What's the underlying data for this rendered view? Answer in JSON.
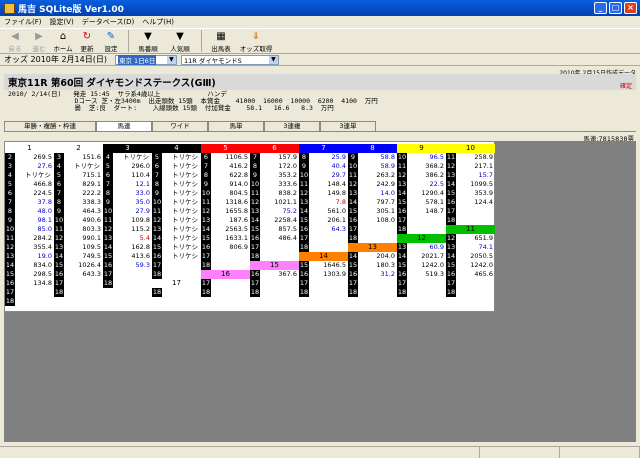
{
  "window": {
    "title": "馬吉 SQLite版  Ver1.00"
  },
  "menu": [
    "ファイル(F)",
    "設定(V)",
    "データベース(D)",
    "ヘルプ(H)"
  ],
  "toolbar": [
    {
      "label": "戻る",
      "icon": "back-arrow-icon",
      "disabled": true
    },
    {
      "label": "進む",
      "icon": "forward-arrow-icon",
      "disabled": true
    },
    {
      "label": "ホーム",
      "icon": "home-icon",
      "disabled": false
    },
    {
      "label": "更新",
      "icon": "refresh-icon",
      "disabled": false
    },
    {
      "label": "設定",
      "icon": "settings-icon",
      "disabled": false
    },
    {
      "label": "馬番順",
      "icon": "sort-down-icon",
      "disabled": false
    },
    {
      "label": "人気順",
      "icon": "sort-down-icon",
      "disabled": false
    },
    {
      "label": "出馬表",
      "icon": "table-icon",
      "disabled": false
    },
    {
      "label": "オッズ取得",
      "icon": "download-icon",
      "disabled": false
    }
  ],
  "nav": {
    "label": "オッズ 2010年 2月14日(日)",
    "venue": "東京 1日6日",
    "race": "11R ダイヤモンドS"
  },
  "date_note": "2010年 2月15日作成データ",
  "race": {
    "title": "東京11R 第60回 ダイヤモンドステークス(GⅢ)",
    "status": "確定",
    "info": [
      "2010/ 2/14(日)   発走 15:45  サラ系4歳以上            ハンデ",
      "                 Dコース 芝・左3400m  出走頭数 15頭  本賞金    41000  16000  10000  6200  4100  万円",
      "                 曇  芝:良  ダート:    入線頭数 15頭  付加賞金    58.1   16.6   8.3  万円"
    ]
  },
  "tabs": [
    "単勝・複勝・枠連",
    "馬連",
    "ワイド",
    "馬単",
    "3連複",
    "3連単"
  ],
  "active_tab": 1,
  "votes": "馬連:7815838票",
  "grid": {
    "headers": [
      {
        "label": "1",
        "bg": "#ffffff",
        "fg": "#000000"
      },
      {
        "label": "2",
        "bg": "#ffffff",
        "fg": "#000000"
      },
      {
        "label": "3",
        "bg": "#000000",
        "fg": "#ffffff"
      },
      {
        "label": "4",
        "bg": "#000000",
        "fg": "#ffffff"
      },
      {
        "label": "5",
        "bg": "#ff0000",
        "fg": "#ffffff"
      },
      {
        "label": "6",
        "bg": "#ff0000",
        "fg": "#ffffff"
      },
      {
        "label": "7",
        "bg": "#0000ff",
        "fg": "#ffffff"
      },
      {
        "label": "8",
        "bg": "#0000ff",
        "fg": "#ffffff"
      },
      {
        "label": "9",
        "bg": "#ffff00",
        "fg": "#000000"
      },
      {
        "label": "10",
        "bg": "#ffff00",
        "fg": "#000000"
      }
    ],
    "columns": [
      [
        [
          "2",
          "269.5",
          ""
        ],
        [
          "3",
          "27.6",
          "blue"
        ],
        [
          "4",
          "トリケシ",
          ""
        ],
        [
          "5",
          "466.8",
          ""
        ],
        [
          "6",
          "224.5",
          ""
        ],
        [
          "7",
          "37.8",
          "blue"
        ],
        [
          "8",
          "48.0",
          "blue"
        ],
        [
          "9",
          "98.1",
          "blue"
        ],
        [
          "10",
          "85.0",
          "blue"
        ],
        [
          "11",
          "284.2",
          ""
        ],
        [
          "12",
          "355.4",
          ""
        ],
        [
          "13",
          "19.0",
          "blue"
        ],
        [
          "14",
          "834.0",
          ""
        ],
        [
          "15",
          "298.5",
          ""
        ],
        [
          "16",
          "134.8",
          ""
        ],
        [
          "17",
          "",
          ""
        ],
        [
          "18",
          "",
          ""
        ]
      ],
      [
        [
          "3",
          "151.6",
          ""
        ],
        [
          "4",
          "トリケシ",
          ""
        ],
        [
          "5",
          "715.1",
          ""
        ],
        [
          "6",
          "829.1",
          ""
        ],
        [
          "7",
          "222.2",
          ""
        ],
        [
          "8",
          "338.3",
          ""
        ],
        [
          "9",
          "464.3",
          ""
        ],
        [
          "10",
          "490.6",
          ""
        ],
        [
          "11",
          "803.3",
          ""
        ],
        [
          "12",
          "990.1",
          ""
        ],
        [
          "13",
          "109.5",
          ""
        ],
        [
          "14",
          "749.5",
          ""
        ],
        [
          "15",
          "1026.4",
          ""
        ],
        [
          "16",
          "643.3",
          ""
        ],
        [
          "17",
          "",
          ""
        ],
        [
          "18",
          "",
          ""
        ]
      ],
      [
        [
          "4",
          "トリケシ",
          ""
        ],
        [
          "5",
          "296.0",
          ""
        ],
        [
          "6",
          "110.4",
          ""
        ],
        [
          "7",
          "12.1",
          "blue"
        ],
        [
          "8",
          "33.0",
          "blue"
        ],
        [
          "9",
          "35.0",
          "blue"
        ],
        [
          "10",
          "27.9",
          "blue"
        ],
        [
          "11",
          "109.8",
          ""
        ],
        [
          "12",
          "115.2",
          ""
        ],
        [
          "13",
          "5.4",
          "red"
        ],
        [
          "14",
          "162.8",
          ""
        ],
        [
          "15",
          "413.6",
          ""
        ],
        [
          "16",
          "59.3",
          "blue"
        ],
        [
          "17",
          "",
          ""
        ],
        [
          "18",
          "",
          ""
        ]
      ],
      [
        [
          "5",
          "トリケシ",
          ""
        ],
        [
          "6",
          "トリケシ",
          ""
        ],
        [
          "7",
          "トリケシ",
          ""
        ],
        [
          "8",
          "トリケシ",
          ""
        ],
        [
          "9",
          "トリケシ",
          ""
        ],
        [
          "10",
          "トリケシ",
          ""
        ],
        [
          "11",
          "トリケシ",
          ""
        ],
        [
          "12",
          "トリケシ",
          ""
        ],
        [
          "13",
          "トリケシ",
          ""
        ],
        [
          "14",
          "トリケシ",
          ""
        ],
        [
          "15",
          "トリケシ",
          ""
        ],
        [
          "16",
          "トリケシ",
          ""
        ],
        [
          "17",
          "",
          ""
        ],
        [
          "18",
          "",
          ""
        ]
      ],
      [
        [
          "6",
          "1106.5",
          ""
        ],
        [
          "7",
          "416.2",
          ""
        ],
        [
          "8",
          "622.8",
          ""
        ],
        [
          "9",
          "914.0",
          ""
        ],
        [
          "10",
          "804.5",
          ""
        ],
        [
          "11",
          "1318.6",
          ""
        ],
        [
          "12",
          "1655.8",
          ""
        ],
        [
          "13",
          "187.6",
          ""
        ],
        [
          "14",
          "2563.5",
          ""
        ],
        [
          "15",
          "1633.1",
          ""
        ],
        [
          "16",
          "806.9",
          ""
        ],
        [
          "17",
          "",
          ""
        ],
        [
          "18",
          "",
          ""
        ]
      ],
      [
        [
          "7",
          "157.9",
          ""
        ],
        [
          "8",
          "172.0",
          ""
        ],
        [
          "9",
          "353.2",
          ""
        ],
        [
          "10",
          "333.6",
          ""
        ],
        [
          "11",
          "838.2",
          ""
        ],
        [
          "12",
          "1021.1",
          ""
        ],
        [
          "13",
          "75.2",
          "blue"
        ],
        [
          "14",
          "2258.4",
          ""
        ],
        [
          "15",
          "857.5",
          ""
        ],
        [
          "16",
          "486.4",
          ""
        ],
        [
          "17",
          "",
          ""
        ],
        [
          "18",
          "",
          ""
        ]
      ],
      [
        [
          "8",
          "25.9",
          "blue"
        ],
        [
          "9",
          "40.4",
          "blue"
        ],
        [
          "10",
          "29.7",
          "blue"
        ],
        [
          "11",
          "148.4",
          ""
        ],
        [
          "12",
          "149.8",
          ""
        ],
        [
          "13",
          "7.8",
          "red"
        ],
        [
          "14",
          "561.0",
          ""
        ],
        [
          "15",
          "206.1",
          ""
        ],
        [
          "16",
          "64.3",
          "blue"
        ],
        [
          "17",
          "",
          ""
        ],
        [
          "18",
          "",
          ""
        ]
      ],
      [
        [
          "9",
          "58.8",
          "blue"
        ],
        [
          "10",
          "58.9",
          "blue"
        ],
        [
          "11",
          "263.2",
          ""
        ],
        [
          "12",
          "242.9",
          ""
        ],
        [
          "13",
          "14.0",
          "blue"
        ],
        [
          "14",
          "797.7",
          ""
        ],
        [
          "15",
          "305.1",
          ""
        ],
        [
          "16",
          "108.0",
          ""
        ],
        [
          "17",
          "",
          ""
        ],
        [
          "18",
          "",
          ""
        ]
      ],
      [
        [
          "10",
          "96.5",
          "blue"
        ],
        [
          "11",
          "368.2",
          ""
        ],
        [
          "12",
          "386.2",
          ""
        ],
        [
          "13",
          "22.5",
          "blue"
        ],
        [
          "14",
          "1290.4",
          ""
        ],
        [
          "15",
          "578.1",
          ""
        ],
        [
          "16",
          "148.7",
          ""
        ],
        [
          "17",
          "",
          ""
        ],
        [
          "18",
          "",
          ""
        ]
      ],
      [
        [
          "11",
          "258.9",
          ""
        ],
        [
          "12",
          "217.1",
          ""
        ],
        [
          "13",
          "15.7",
          "blue"
        ],
        [
          "14",
          "1099.5",
          ""
        ],
        [
          "15",
          "353.9",
          ""
        ],
        [
          "16",
          "124.4",
          ""
        ],
        [
          "17",
          "",
          ""
        ],
        [
          "18",
          "",
          ""
        ]
      ]
    ],
    "lower": [
      {
        "col": 9,
        "header": {
          "label": "11",
          "bg": "#00c000",
          "fg": "#000000"
        },
        "rows": [
          [
            "12",
            "651.9",
            ""
          ],
          [
            "13",
            "74.1",
            "blue"
          ],
          [
            "14",
            "2050.5",
            ""
          ],
          [
            "15",
            "1242.0",
            ""
          ],
          [
            "16",
            "465.6",
            ""
          ],
          [
            "17",
            "",
            ""
          ],
          [
            "18",
            "",
            ""
          ]
        ]
      },
      {
        "col": 8,
        "header": {
          "label": "12",
          "bg": "#00c000",
          "fg": "#000000"
        },
        "rows": [
          [
            "13",
            "60.9",
            "blue"
          ],
          [
            "14",
            "2021.7",
            ""
          ],
          [
            "15",
            "1242.0",
            ""
          ],
          [
            "16",
            "519.3",
            ""
          ],
          [
            "17",
            "",
            ""
          ],
          [
            "18",
            "",
            ""
          ]
        ]
      },
      {
        "col": 7,
        "header": {
          "label": "13",
          "bg": "#ff8000",
          "fg": "#000000"
        },
        "rows": [
          [
            "14",
            "",
            ""
          ],
          [
            "15",
            "",
            ""
          ],
          [
            "16",
            "",
            ""
          ],
          [
            "17",
            "",
            ""
          ],
          [
            "18",
            "",
            ""
          ]
        ]
      },
      {
        "col": 6,
        "header": {
          "label": "14",
          "bg": "#ff8000",
          "fg": "#000000"
        },
        "rows": [
          [
            "15",
            "1646.5",
            ""
          ],
          [
            "16",
            "1303.9",
            ""
          ],
          [
            "17",
            "",
            ""
          ],
          [
            "18",
            "",
            ""
          ]
        ]
      },
      {
        "col": 5,
        "header": {
          "label": "15",
          "bg": "#ff80ff",
          "fg": "#000000"
        },
        "rows": [
          [
            "16",
            "367.6",
            ""
          ],
          [
            "17",
            "",
            ""
          ],
          [
            "18",
            "",
            ""
          ]
        ]
      },
      {
        "col": 4,
        "header": {
          "label": "16",
          "bg": "#ff80ff",
          "fg": "#000000"
        },
        "rows": [
          [
            "17",
            "",
            ""
          ],
          [
            "18",
            "",
            ""
          ]
        ]
      },
      {
        "col": 3,
        "header": {
          "label": "17",
          "bg": "#ffffff",
          "fg": "#000000"
        },
        "rows": [
          [
            "18",
            "",
            ""
          ]
        ]
      }
    ],
    "col13_extra": [
      [
        "14",
        "204.0",
        ""
      ],
      [
        "15",
        "180.3",
        ""
      ],
      [
        "16",
        "31.2",
        "blue"
      ]
    ]
  }
}
